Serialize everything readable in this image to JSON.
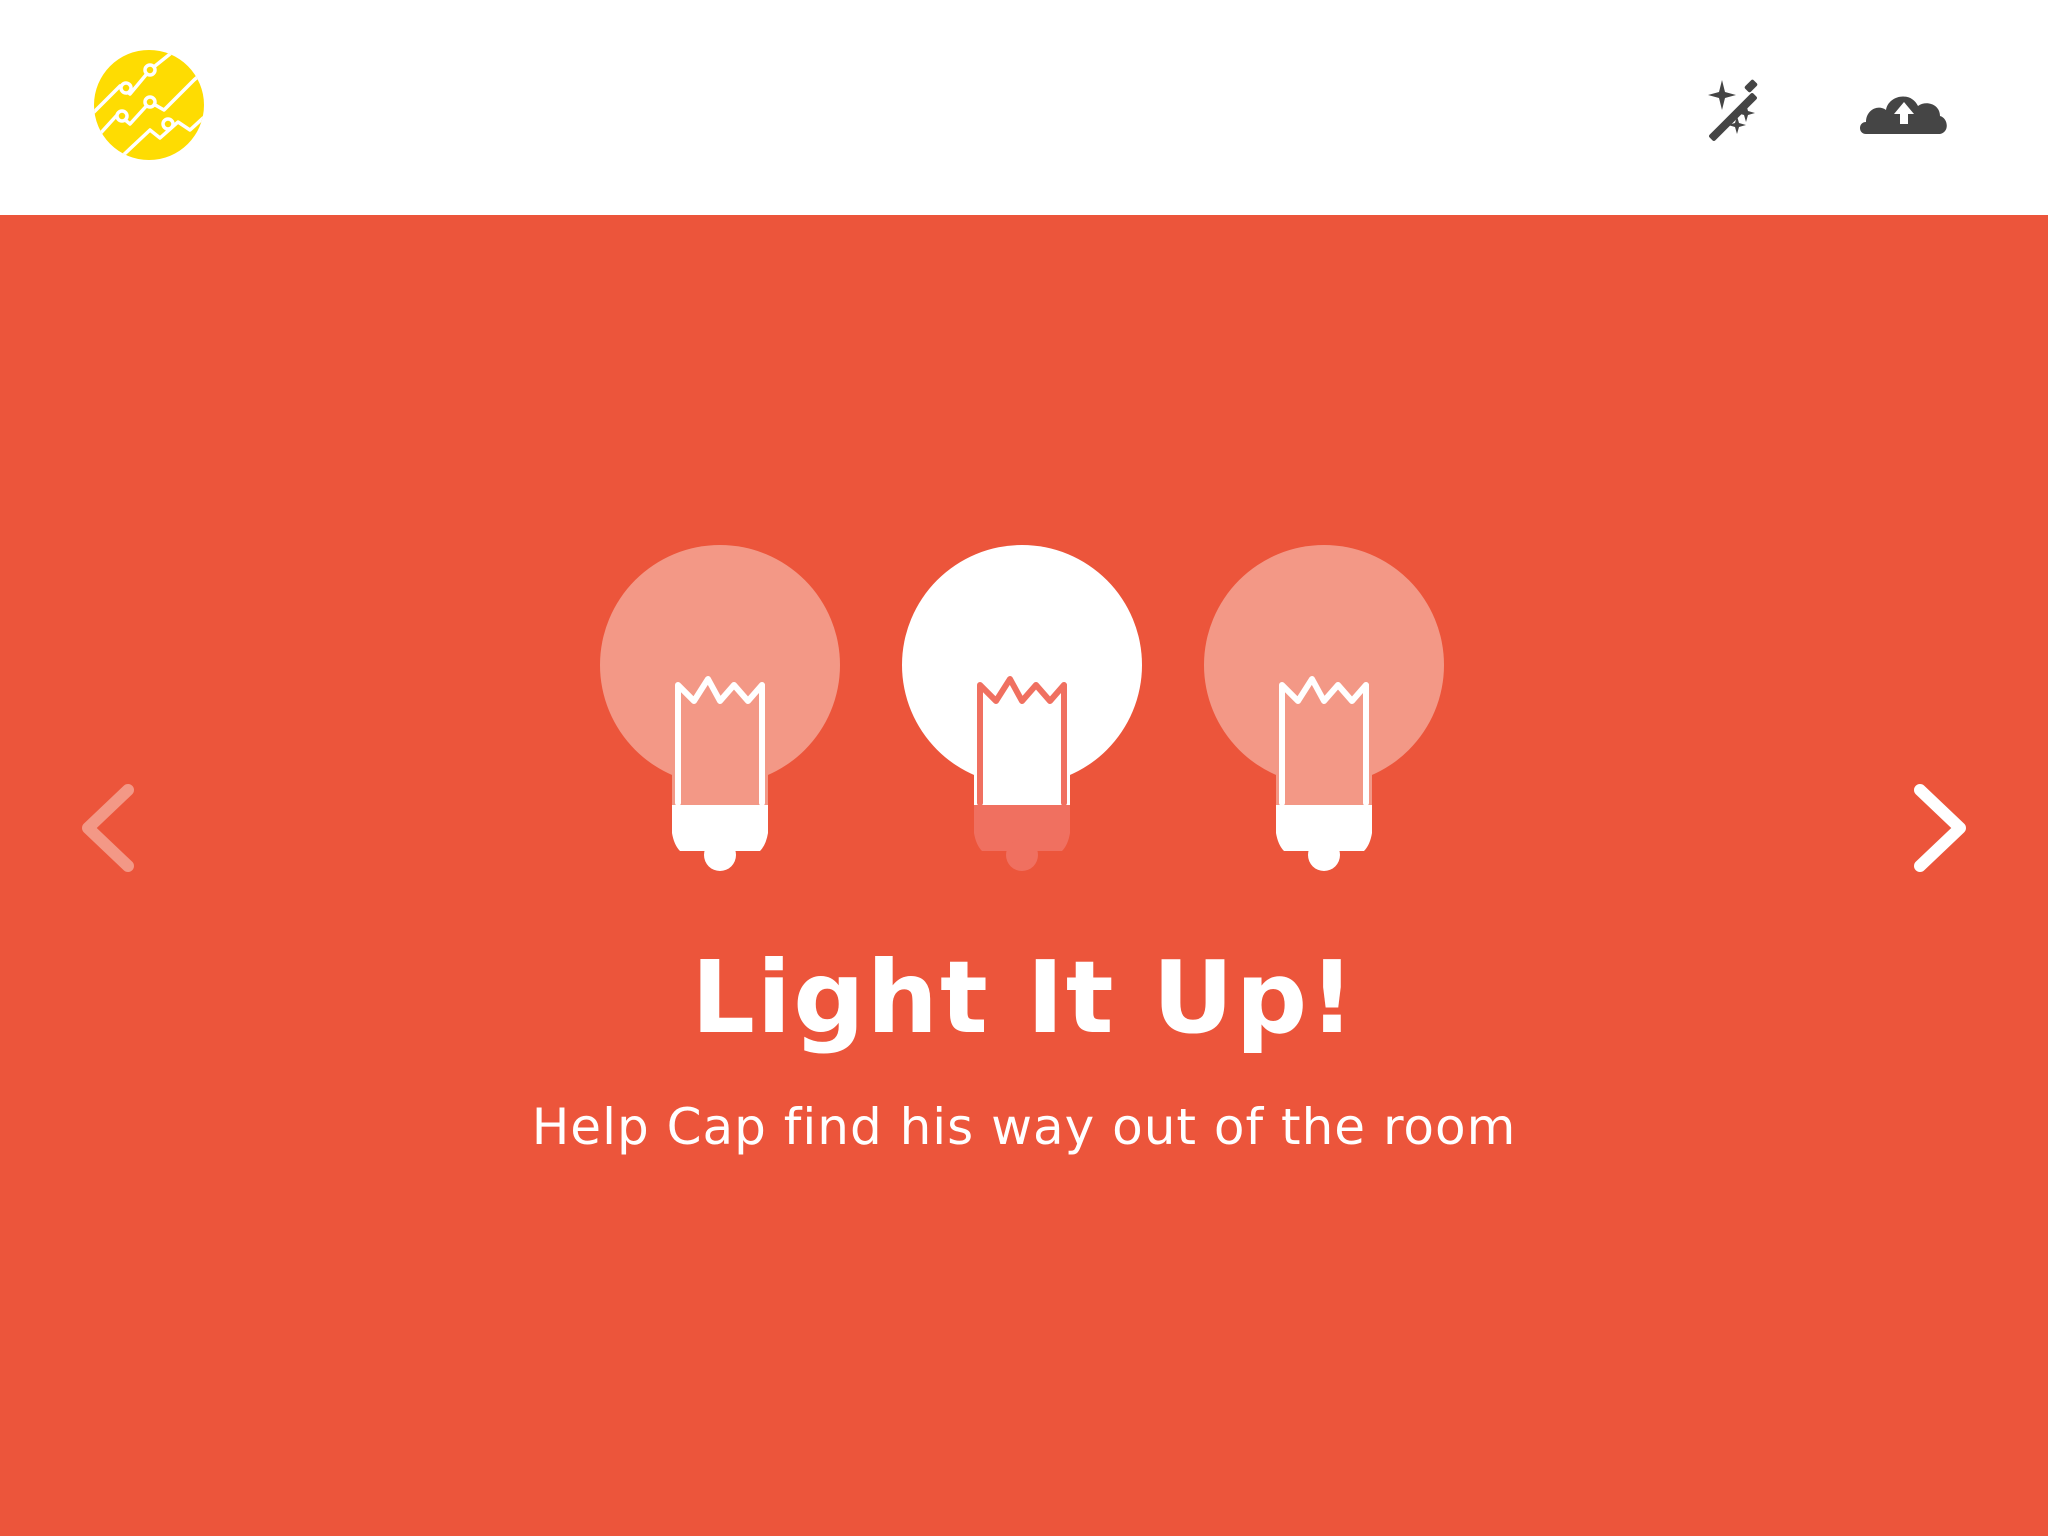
{
  "app": {
    "logo_icon": "circuit-graph-logo",
    "colors": {
      "topbar": "#ffffff",
      "stage": "#ec553b",
      "logo": "#fedc02",
      "icons": "#454545",
      "bulb_on": "#ffffff",
      "bulb_off": "#f39886"
    }
  },
  "toolbar": {
    "magic_icon": "magic-wand-icon",
    "upload_icon": "cloud-upload-icon"
  },
  "carousel": {
    "prev_icon": "chevron-left-icon",
    "next_icon": "chevron-right-icon",
    "bulbs": [
      {
        "state": "off"
      },
      {
        "state": "on"
      },
      {
        "state": "off"
      }
    ]
  },
  "level": {
    "title": "Light It Up!",
    "subtitle": "Help Cap find his way out of the room"
  }
}
